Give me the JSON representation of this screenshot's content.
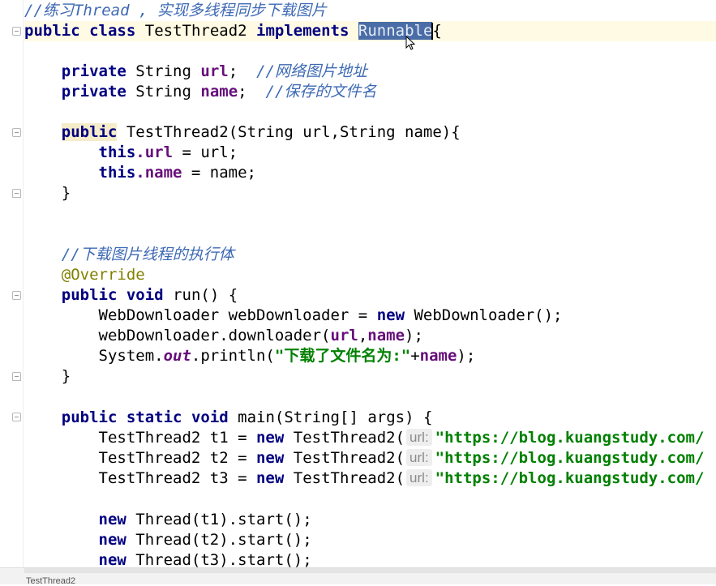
{
  "editor": {
    "file_tab": "TestThread2",
    "comment_header": "//练习Thread , 实现多线程同步下载图片",
    "decl": {
      "kw_public": "public",
      "kw_class": "class",
      "class_name": "TestThread2",
      "kw_implements": "implements",
      "iface": "Runnable",
      "brace": "{"
    },
    "field_url": {
      "kw": "private",
      "type": "String",
      "name": "url",
      "semi": ";",
      "comment": "//网络图片地址"
    },
    "field_name": {
      "kw": "private",
      "type": "String",
      "name": "name",
      "semi": ";",
      "comment": "//保存的文件名"
    },
    "ctor": {
      "kw": "public",
      "sig": "TestThread2(String url,String name){"
    },
    "ctor_body1": {
      "kw_this": "this",
      "dot_field": ".url",
      "rest": " = url;"
    },
    "ctor_body2": {
      "kw_this": "this",
      "dot_field": ".name",
      "rest": " = name;"
    },
    "close_brace": "}",
    "comment_run": "//下载图片线程的执行体",
    "annotation": "@Override",
    "run_sig": {
      "kw_public": "public",
      "kw_void": "void",
      "rest": "run() {"
    },
    "run_body1": {
      "pre": "WebDownloader webDownloader = ",
      "kw_new": "new",
      "post": "WebDownloader();"
    },
    "run_body2": {
      "pre": "webDownloader.downloader(",
      "arg1": "url",
      "comma": ",",
      "arg2": "name",
      "post": ");"
    },
    "run_body3": {
      "pre": "System.",
      "static_field": "out",
      "mid": ".println(",
      "str": "\"下载了文件名为:\"",
      "plus": "+",
      "arg": "name",
      "post": ");"
    },
    "main_sig": {
      "kw_public": "public",
      "kw_static": "static",
      "kw_void": "void",
      "rest": "main(String[] args) {"
    },
    "main_t1": {
      "pre": "TestThread2 t1 = ",
      "kw_new": "new",
      "ctor": "TestThread2(",
      "hint": "url:",
      "str": "\"https://blog.kuangstudy.com/"
    },
    "main_t2": {
      "pre": "TestThread2 t2 = ",
      "kw_new": "new",
      "ctor": "TestThread2(",
      "hint": "url:",
      "str": "\"https://blog.kuangstudy.com/"
    },
    "main_t3": {
      "pre": "TestThread2 t3 = ",
      "kw_new": "new",
      "ctor": "TestThread2(",
      "hint": "url:",
      "str": "\"https://blog.kuangstudy.com/"
    },
    "start1": {
      "kw_new": "new",
      "rest": "Thread(t1).start();"
    },
    "start2": {
      "kw_new": "new",
      "rest": "Thread(t2).start();"
    },
    "start3": {
      "kw_new": "new",
      "rest": "Thread(t3).start();"
    }
  }
}
